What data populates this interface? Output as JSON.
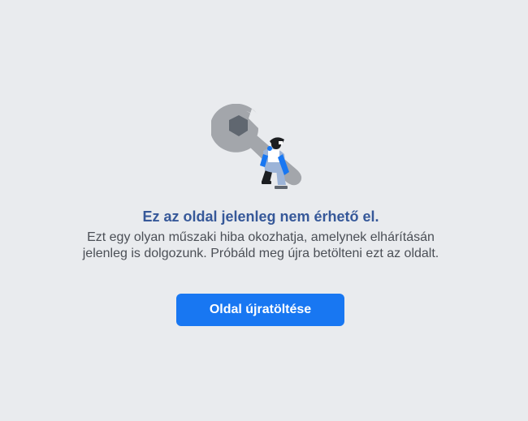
{
  "error": {
    "illustration_icon": "wrench-mechanic-icon",
    "title": "Ez az oldal jelenleg nem érhető el.",
    "description": "Ezt egy olyan műszaki hiba okozhatja, amelynek elhárításán jelenleg is dolgozunk. Próbáld meg újra betölteni ezt az oldalt.",
    "reload_button_label": "Oldal újratöltése"
  },
  "colors": {
    "background": "#e9ebee",
    "title": "#365899",
    "description": "#4b4f56",
    "button": "#1877f2",
    "button_text": "#ffffff"
  }
}
